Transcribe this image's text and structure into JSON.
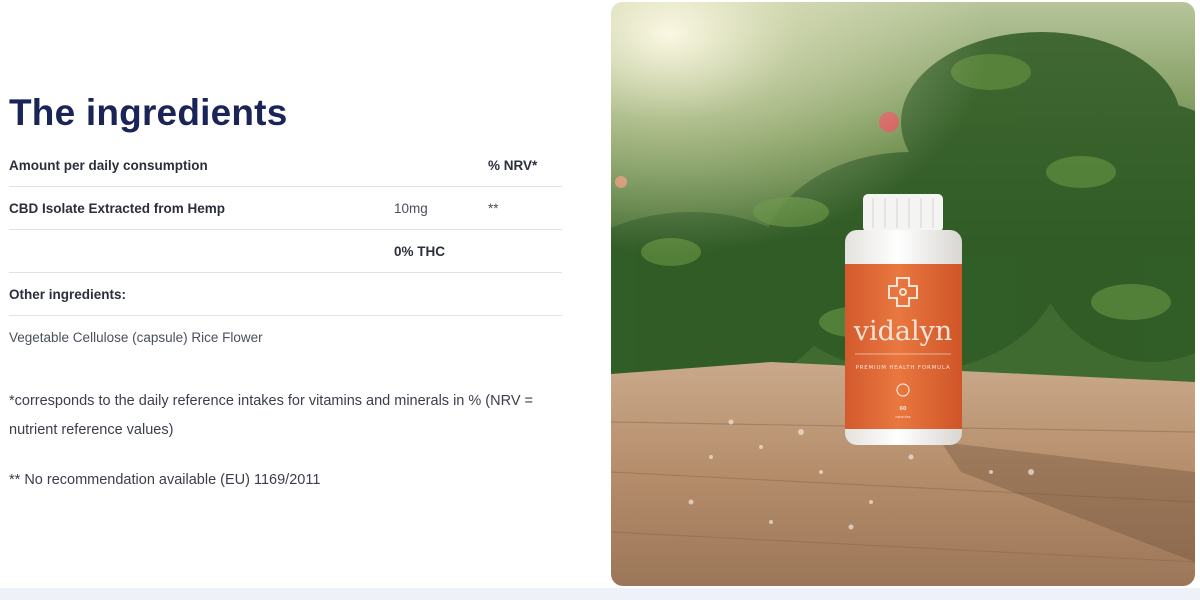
{
  "title": "The ingredients",
  "table": {
    "header": {
      "label": "Amount per daily consumption",
      "nrv": "% NRV*"
    },
    "row1": {
      "label": "CBD Isolate Extracted from Hemp",
      "amount": "10mg",
      "nrv": "**"
    },
    "row2": {
      "amount": "0% THC"
    },
    "other_header": "Other ingredients:",
    "other_value": "Vegetable Cellulose (capsule) Rice Flower"
  },
  "notes": {
    "nrv_note": "*corresponds to the daily reference intakes for vitamins and minerals in % (NRV = nutrient reference values)",
    "eu_note": "** No recommendation available (EU) 1169/2011"
  },
  "product": {
    "brand": "vidalyn",
    "subtitle": "PREMIUM HEALTH FORMULA",
    "count": "60",
    "count_label": "capsules",
    "label_color": "#e06a3c",
    "cap_color": "#f4f4f2"
  }
}
